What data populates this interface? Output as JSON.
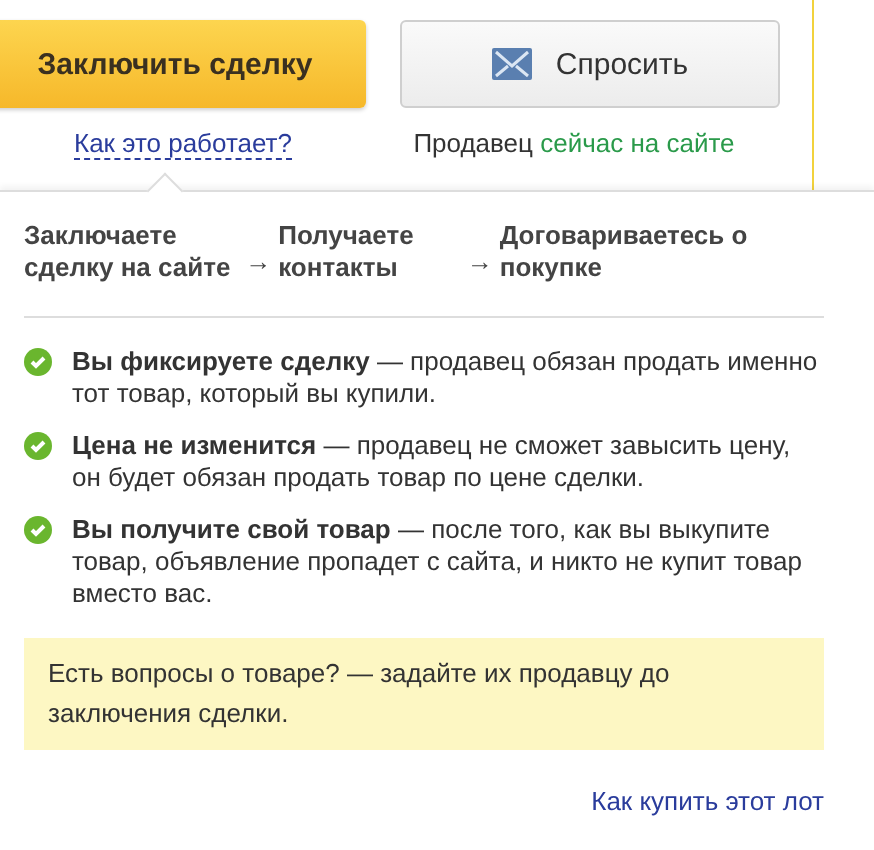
{
  "actions": {
    "deal_button": "Заключить сделку",
    "ask_button": "Спросить",
    "how_link": "Как это работает?",
    "seller_label": "Продавец",
    "seller_status": "сейчас на сайте"
  },
  "steps": [
    {
      "label": "Заключаете сделку на сайте",
      "arrow": "→"
    },
    {
      "label": "Получаете контакты",
      "arrow": "→"
    },
    {
      "label": "Договариваетесь о покупке"
    }
  ],
  "benefits": [
    "**Вы фиксируете сделку** — продавец обязан продать именно тот товар, который вы купили.",
    "**Цена не изменится** — продавец не сможет завысить цену, он будет обязан продать товар по цене сделки.",
    "**Вы получите свой товар** — после того, как вы выкупите товар, объявление пропадет с сайта, и никто не купит товар вместо вас."
  ],
  "note": "Есть вопросы о товаре? — задайте их продавцу до заключения сделки.",
  "footer_link": "Как купить этот лот"
}
